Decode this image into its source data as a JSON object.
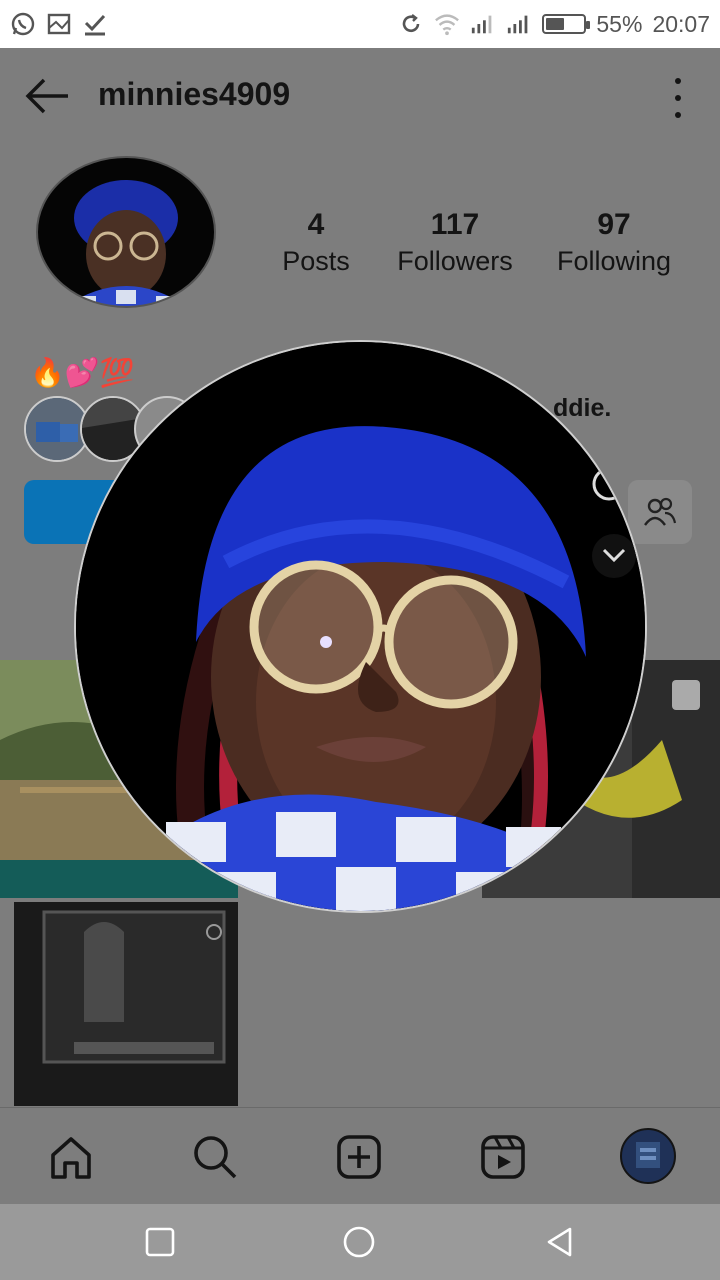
{
  "status_bar": {
    "battery_percent": "55%",
    "time": "20:07",
    "battery_level": 0.55,
    "left_icons": [
      "whatsapp-icon",
      "screenshot-icon",
      "check-icon"
    ],
    "right_icons": [
      "sync-icon",
      "wifi-icon",
      "signal-icon",
      "signal-icon",
      "battery-icon"
    ]
  },
  "header": {
    "username": "minnies4909",
    "back_icon": "arrow-left-icon",
    "menu_icon": "more-vertical-icon"
  },
  "profile": {
    "stats": [
      {
        "value": "4",
        "label": "Posts"
      },
      {
        "value": "117",
        "label": "Followers"
      },
      {
        "value": "97",
        "label": "Following"
      }
    ],
    "bio_emojis": "🔥💕💯",
    "bio_fragment": "ddie."
  },
  "bottom_nav": {
    "items": [
      "home-icon",
      "search-icon",
      "create-icon",
      "reels-icon",
      "profile-avatar"
    ]
  },
  "system_nav": {
    "items": [
      "recents-icon",
      "home-circle-icon",
      "back-triangle-icon"
    ]
  },
  "colors": {
    "overlay": "#7d7d7d",
    "follow_button": "#0a73b6",
    "beanie": "#1a32c8"
  }
}
